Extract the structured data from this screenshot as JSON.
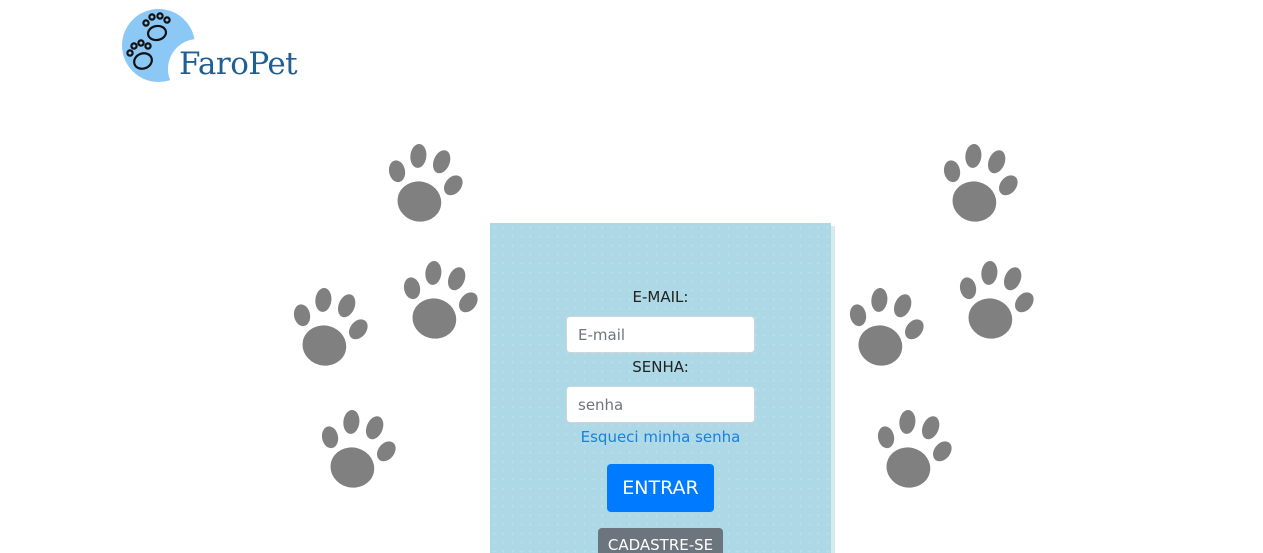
{
  "brand": {
    "name": "FaroPet",
    "logo_icon": "paw-prints-icon",
    "primary_color": "#1f5f95",
    "circle_color": "#8cc8f5"
  },
  "login": {
    "email_label": "E-MAIL:",
    "email_placeholder": "E-mail",
    "email_value": "",
    "password_label": "SENHA:",
    "password_placeholder": "senha",
    "password_value": "",
    "forgot_link": "Esqueci minha senha",
    "submit_label": "ENTRAR",
    "register_label": "CADASTRE-SE"
  },
  "colors": {
    "card_background": "#add8e6",
    "primary_button": "#007bff",
    "secondary_button": "#6c757d",
    "link": "#1b7fe0",
    "paw": "#808080"
  },
  "decorations": {
    "icon": "paw-print-icon",
    "count": 8
  }
}
